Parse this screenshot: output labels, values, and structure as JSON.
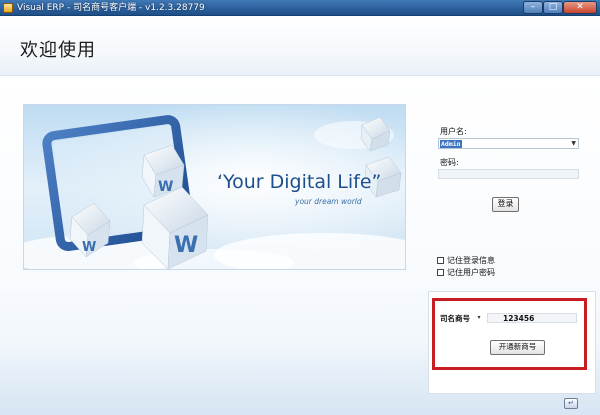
{
  "window": {
    "title": "Visual ERP - 司名商号客户端 - v1.2.3.28779",
    "minimize_icon": "minimize-icon",
    "maximize_icon": "maximize-icon",
    "close_icon": "close-icon"
  },
  "header": {
    "welcome": "欢迎使用"
  },
  "banner": {
    "headline": "‘Your Digital Life”",
    "tagline": "your dream world",
    "fine_print": "",
    "cube_letter": "W"
  },
  "login": {
    "username_label": "用户名:",
    "username_value": "Admin",
    "password_label": "密码:",
    "password_value": "",
    "login_button": "登录",
    "remember_login": "记住登录信息",
    "remember_password": "记住用户密码"
  },
  "merchant": {
    "label": "司名商号",
    "dropdown_glyph": "▾",
    "value": "123456",
    "open_button": "开通新商号"
  },
  "colors": {
    "titlebar": "#2c5f9a",
    "highlight": "#c81d22",
    "selection": "#3d73c0"
  },
  "footer": {
    "corner_icon": "exit-icon"
  }
}
